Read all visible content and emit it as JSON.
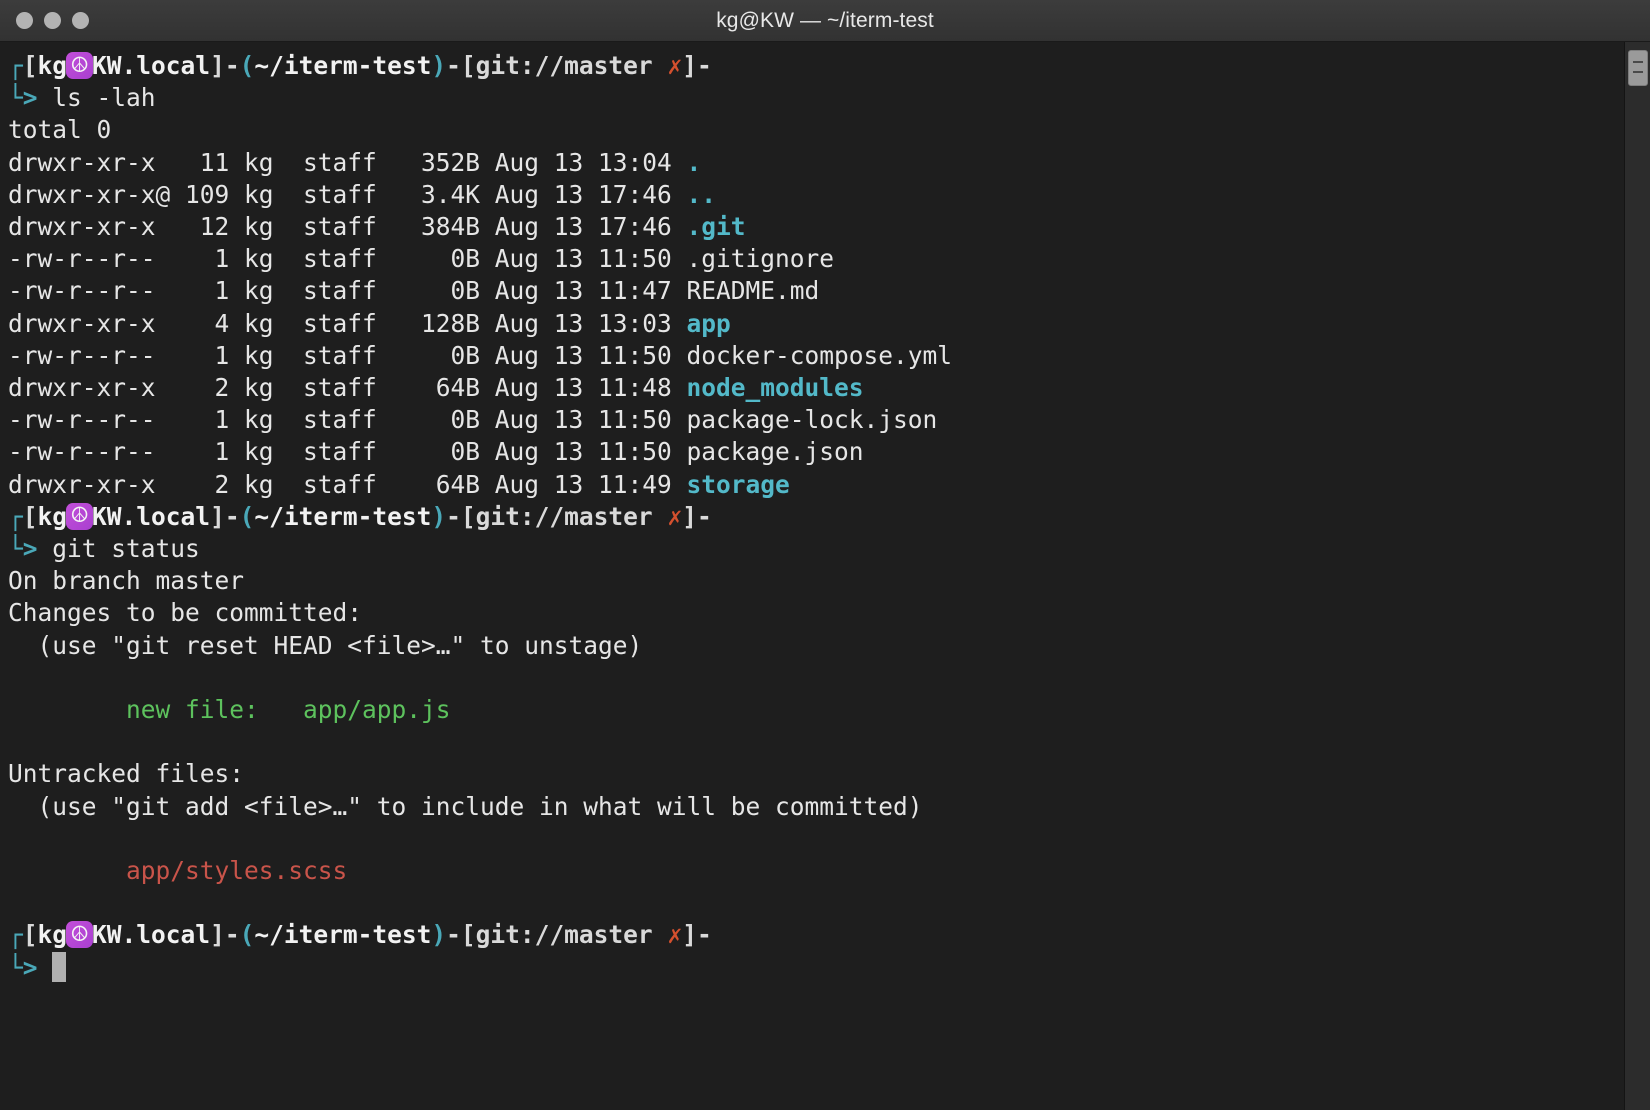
{
  "window": {
    "title": "kg@KW — ~/iterm-test",
    "traffic_lights": [
      "close-button",
      "minimize-button",
      "zoom-button"
    ]
  },
  "colors": {
    "background": "#1e1e1e",
    "titlebar": "#353535",
    "foreground": "#e6e6e6",
    "directory": "#53b9c9",
    "prompt_accent": "#4aa8b8",
    "git_dirty": "#d4502e",
    "staged": "#5dc25d",
    "untracked": "#c9544a",
    "badge": "#b843cf"
  },
  "prompt": {
    "corner_top": "┌",
    "corner_bottom": "└",
    "arrow": ">",
    "user": "kg",
    "at_badge_icon": "peace-emoji",
    "host": "KW.local",
    "path": "~/iterm-test",
    "git_label": "git://master",
    "git_dirty_mark": "✗",
    "open_bracket": "[",
    "close_bracket": "]",
    "open_paren": "(",
    "close_paren": ")",
    "dash": "-"
  },
  "commands": {
    "first": "ls -lah",
    "second": "git status"
  },
  "ls_output": {
    "total": "total 0",
    "rows": [
      {
        "perms": "drwxr-xr-x ",
        "links": " 11",
        "user": "kg",
        "group": "staff",
        "size": "352B",
        "date": "Aug 13 13:04",
        "name": ".",
        "type": "dir"
      },
      {
        "perms": "drwxr-xr-x@",
        "links": "109",
        "user": "kg",
        "group": "staff",
        "size": "3.4K",
        "date": "Aug 13 17:46",
        "name": "..",
        "type": "dir"
      },
      {
        "perms": "drwxr-xr-x ",
        "links": " 12",
        "user": "kg",
        "group": "staff",
        "size": "384B",
        "date": "Aug 13 17:46",
        "name": ".git",
        "type": "dir"
      },
      {
        "perms": "-rw-r--r-- ",
        "links": "  1",
        "user": "kg",
        "group": "staff",
        "size": "  0B",
        "date": "Aug 13 11:50",
        "name": ".gitignore",
        "type": "file"
      },
      {
        "perms": "-rw-r--r-- ",
        "links": "  1",
        "user": "kg",
        "group": "staff",
        "size": "  0B",
        "date": "Aug 13 11:47",
        "name": "README.md",
        "type": "file"
      },
      {
        "perms": "drwxr-xr-x ",
        "links": "  4",
        "user": "kg",
        "group": "staff",
        "size": "128B",
        "date": "Aug 13 13:03",
        "name": "app",
        "type": "dir"
      },
      {
        "perms": "-rw-r--r-- ",
        "links": "  1",
        "user": "kg",
        "group": "staff",
        "size": "  0B",
        "date": "Aug 13 11:50",
        "name": "docker-compose.yml",
        "type": "file"
      },
      {
        "perms": "drwxr-xr-x ",
        "links": "  2",
        "user": "kg",
        "group": "staff",
        "size": " 64B",
        "date": "Aug 13 11:48",
        "name": "node_modules",
        "type": "dir"
      },
      {
        "perms": "-rw-r--r-- ",
        "links": "  1",
        "user": "kg",
        "group": "staff",
        "size": "  0B",
        "date": "Aug 13 11:50",
        "name": "package-lock.json",
        "type": "file"
      },
      {
        "perms": "-rw-r--r-- ",
        "links": "  1",
        "user": "kg",
        "group": "staff",
        "size": "  0B",
        "date": "Aug 13 11:50",
        "name": "package.json",
        "type": "file"
      },
      {
        "perms": "drwxr-xr-x ",
        "links": "  2",
        "user": "kg",
        "group": "staff",
        "size": " 64B",
        "date": "Aug 13 11:49",
        "name": "storage",
        "type": "dir"
      }
    ]
  },
  "git_status": {
    "branch_line": "On branch master",
    "staged_header": "Changes to be committed:",
    "staged_hint": "  (use \"git reset HEAD <file>…\" to unstage)",
    "staged_files": [
      "        new file:   app/app.js"
    ],
    "untracked_header": "Untracked files:",
    "untracked_hint": "  (use \"git add <file>…\" to include in what will be committed)",
    "untracked_files": [
      "        app/styles.scss"
    ]
  }
}
